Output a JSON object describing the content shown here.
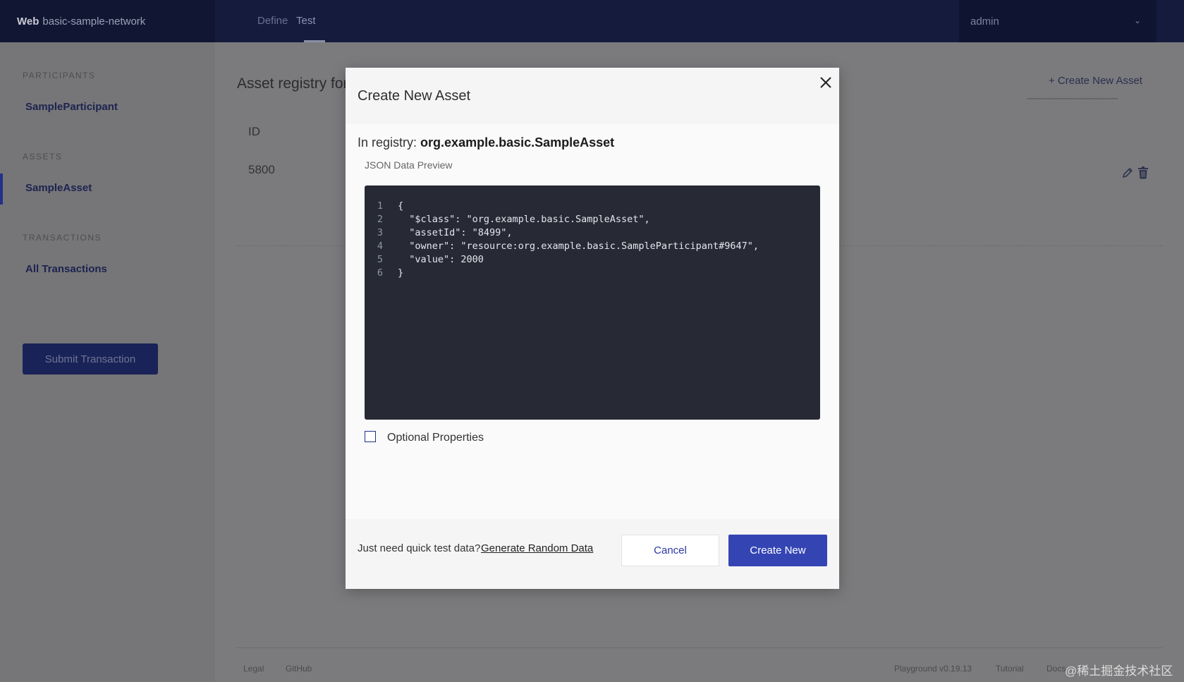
{
  "app": {
    "brand_bold": "Web",
    "brand_name": "basic-sample-network",
    "nav_tabs": [
      "Define",
      "Test"
    ],
    "active_tab": "Test",
    "user": "admin"
  },
  "sidebar": {
    "sections": [
      {
        "heading": "PARTICIPANTS",
        "items": [
          "SampleParticipant"
        ]
      },
      {
        "heading": "ASSETS",
        "items": [
          "SampleAsset"
        ]
      },
      {
        "heading": "TRANSACTIONS",
        "items": [
          "All Transactions"
        ]
      }
    ],
    "submit_label": "Submit Transaction"
  },
  "main": {
    "title": "Asset registry for",
    "create_link": "+ Create New Asset",
    "column_id": "ID",
    "row_id": "5800"
  },
  "footer": {
    "legal": "Legal",
    "github": "GitHub",
    "version": "Playground v0.19.13",
    "tutorial": "Tutorial",
    "docs": "Docs"
  },
  "modal": {
    "title": "Create New Asset",
    "registry_prefix": "In registry:",
    "registry_name": "org.example.basic.SampleAsset",
    "json_label": "JSON Data Preview",
    "code_lines": [
      "{",
      "  \"$class\": \"org.example.basic.SampleAsset\",",
      "  \"assetId\": \"8499\",",
      "  \"owner\": \"resource:org.example.basic.SampleParticipant#9647\",",
      "  \"value\": 2000",
      "}"
    ],
    "line_numbers": [
      "1",
      "2",
      "3",
      "4",
      "5",
      "6"
    ],
    "optional_label": "Optional Properties",
    "optional_checked": false,
    "quick_text": "Just need quick test data?",
    "generate_link": "Generate Random Data",
    "cancel_label": "Cancel",
    "create_label": "Create New"
  },
  "watermark": "@稀土掘金技术社区",
  "colors": {
    "topbar": "#141b3d",
    "overlay_bg": "#7b7b7d",
    "editor_bg": "#272a35",
    "primary_button": "#3445b3"
  }
}
